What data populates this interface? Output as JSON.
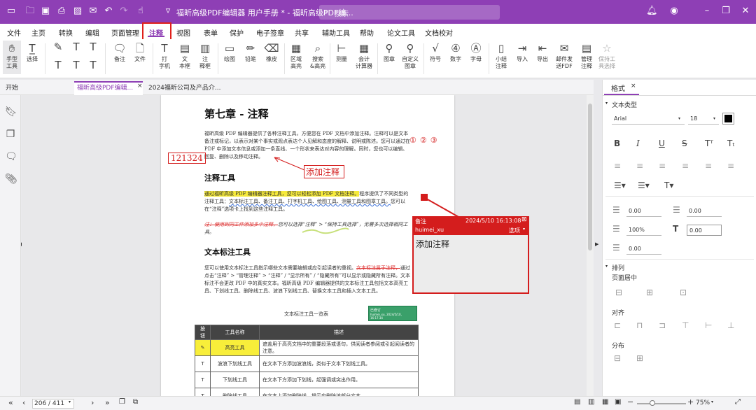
{
  "titlebar": {
    "title": "福昕高级PDF编辑器 用户手册 * - 福昕高级PDF编...",
    "search_placeholder": "搜索"
  },
  "menu": [
    "文件",
    "主页",
    "转换",
    "编辑",
    "页面管理",
    "注释",
    "视图",
    "表单",
    "保护",
    "电子签章",
    "共享",
    "辅助工具",
    "帮助",
    "论文工具",
    "文档校对"
  ],
  "ribbon": {
    "hand": "手型\n工具",
    "select": "选择",
    "note": "备注",
    "file": "文件",
    "typewriter": "打\n字机",
    "textbox": "文\n本框",
    "callout": "注\n释框",
    "shape": "绘图",
    "pencil": "铅笔",
    "eraser": "橡皮",
    "area_hl": "区域\n高亮",
    "search_hl": "搜索\n&高亮",
    "measure": "测量",
    "calc": "会计\n计算器",
    "stamp": "图章",
    "custom_stamp": "自定义\n图章",
    "symbol": "符号",
    "number": "数字",
    "letter": "字母",
    "summary": "小结\n注释",
    "import": "导入",
    "export": "导出",
    "email": "邮件发\n送FDF",
    "manage": "管理\n注释",
    "keep_tool": "保持工\n具选择"
  },
  "tabs": [
    "开始",
    "福昕高级PDF编辑...",
    "2024福昕公司及产品介..."
  ],
  "page": {
    "chapter": "第七章 - 注释",
    "intro": "福昕高级 PDF 编辑器提供了各种注释工具，方便您在 PDF 文档中添加注释。注释可以是文本备注或标记，以表示对某个事实或观点表达个人见解和态度的解释、说明或陈述。您可以通过在 PDF 中添加文本信息或添加一条直线、一个形状来表达对内容的理解。同时，您也可以编辑、回复、删除以及移动注释。",
    "circles": [
      "①",
      "②",
      "③"
    ],
    "red_number": "121324",
    "add_note_label": "添加注释",
    "sec1": "注释工具",
    "sec1_hl": "通过福昕高级 PDF 编辑器注释工具，您可以轻松添加 PDF 文档注释。",
    "sec1_rest": "程序提供了不同类型的注释工具：",
    "sec1_blue": "文本标注工具、备注工具、打字机工具、绘图工具、测量工具和图章工具。",
    "sec1_tail": "您可以在“注释”选项卡上找到这些注释工具。",
    "note_italic_strike": "注：使用到同工作添加多个注释，",
    "note_italic": "您可以选择“注释” > “保持工具选择”，无需多次选择相同工具。",
    "sec2": "文本标注工具",
    "sec2_a": "您可以使用文本标注工具指示哪些文本需要编辑或应引起读者的重视。",
    "sec2_strike": "文本标注属于注释，",
    "sec2_b": "通过点击“注释” > “管理注释” > “注释” / “显示所有” / “隐藏所有”可以显示或隐藏所有注释。文本标注不会更改 PDF 中的真实文本。福昕高级 PDF 编辑器提供的文本标注工具包括文本高亮工具、下划线工具、删除线工具、波浪下划线工具、替换文本工具和插入文本工具。",
    "table_caption": "文本标注工具一览表",
    "stamp_text": "已修订",
    "stamp_sub": "huimei_xu, 2024/5/10, 16:17:34",
    "table_headers": [
      "按钮",
      "工具名称",
      "描述"
    ],
    "rows": [
      {
        "name": "高亮工具",
        "desc": "遮盖用于高亮文档中的重要段落或语句，供阅读者参阅或引起阅读者的注意。"
      },
      {
        "name": "波浪下划线工具",
        "desc": "在文本下方添加波浪线，类似于文本下划线工具。"
      },
      {
        "name": "下划线工具",
        "desc": "在文本下方添加下划线，起强调或突出作用。"
      },
      {
        "name": "删除线工具",
        "desc": "在文本上添加删除线，提示应删除该部分文本。"
      }
    ]
  },
  "comment": {
    "type": "备注",
    "date": "2024/5/10 16:13:08",
    "user": "huimei_xu",
    "options": "选项",
    "body": "添加注释"
  },
  "panel": {
    "tab": "格式",
    "text_type": "文本类型",
    "font": "Arial",
    "size": "18",
    "color": "#000000",
    "spacing": [
      "0.00",
      "0.00",
      "100%",
      "0.00",
      "0.00"
    ],
    "arrange": "排列",
    "page_center": "页面居中",
    "align": "对齐",
    "distribute": "分布"
  },
  "status": {
    "page": "206 / 411",
    "zoom": "75%"
  },
  "colors": {
    "accent": "#8e3fb5",
    "red": "#d41d1d",
    "highlight": "#f6ea3a"
  }
}
